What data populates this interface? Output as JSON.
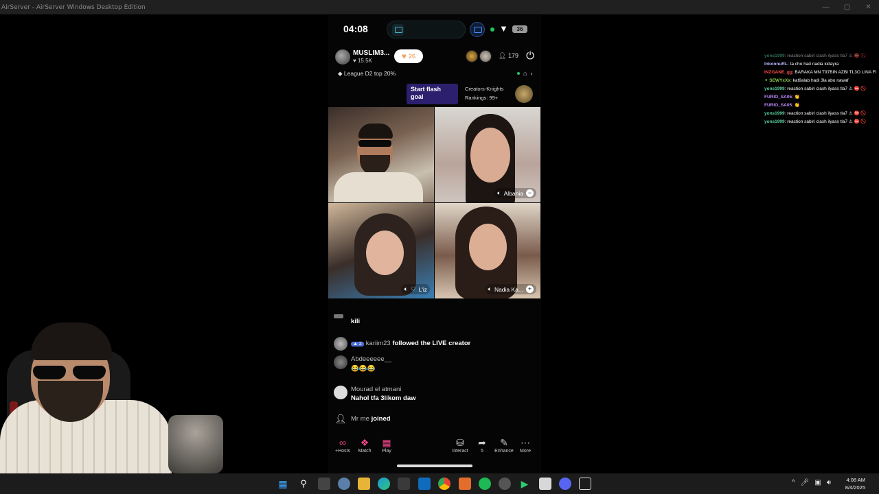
{
  "window": {
    "title": "AirServer - AirServer Windows Desktop Edition",
    "min": "—",
    "max": "▢",
    "close": "✕"
  },
  "status": {
    "time": "04:08",
    "battery": "36"
  },
  "host": {
    "name": "MUSLIM3...",
    "likes": "♥ 15.5K",
    "heart_count": "26",
    "viewers": "179",
    "league": "League D2 top 20%"
  },
  "flash": {
    "label": "Start flash goal",
    "creators_title": "Creators-Knights",
    "rankings": "Rankings: 99+"
  },
  "tiles": [
    {
      "label": ""
    },
    {
      "label": "Albania"
    },
    {
      "label": "L'iz"
    },
    {
      "label": "Nadia Ka..."
    }
  ],
  "chat": [
    {
      "name": "",
      "text": "kili"
    },
    {
      "badge": "2",
      "name": "kariim23",
      "text": "followed the LIVE creator"
    },
    {
      "name": "Abdeeeeee__",
      "text": "😂😂😂"
    },
    {
      "name": "Mourad el atmani",
      "text": "Nahol tfa 3likom daw"
    },
    {
      "name": "Mr me",
      "text": "joined"
    }
  ],
  "toolbar": {
    "hosts": "+Hosts",
    "match": "Match",
    "play": "Play",
    "interact": "Interact",
    "share": "5",
    "enhance": "Enhance",
    "more": "More"
  },
  "sidechat": [
    {
      "user": "yons1999",
      "msg": ": reaction sabiri clash ilyass tla7 ⚠ ⛔ 🚫",
      "color": "#5fd3a0"
    },
    {
      "user": "InkonnuRL",
      "msg": ": ta cho had nadia kidayra",
      "color": "#b7b7ff"
    },
    {
      "user": "INZGANE_gg",
      "msg": ": BARAKA MN T97BIN AZBI TL3O LINA FI",
      "color": "#ff4d4d"
    },
    {
      "user": "SEWYxXx",
      "msg": ": kat9alab hadi 3la abo nawaf",
      "color": "#8fd14f"
    },
    {
      "user": "yons1999",
      "msg": ": reaction sabiri clash ilyass tla7 ⚠ ⛔ 🚫",
      "color": "#5fd3a0"
    },
    {
      "user": "FURIO_SA05",
      "msg": ": 👏",
      "color": "#c08cff"
    },
    {
      "user": "FURIO_SA05",
      "msg": ": 👏",
      "color": "#c08cff"
    },
    {
      "user": "yons1999",
      "msg": ": reaction sabiri clash ilyass tla7 ⚠ ⛔ 🚫",
      "color": "#5fd3a0"
    },
    {
      "user": "yons1999",
      "msg": ": reaction sabiri clash ilyass tla7 ⚠ ⛔ 🚫",
      "color": "#5fd3a0"
    }
  ],
  "taskbar": {
    "time": "4:08 AM",
    "date": "8/4/2025",
    "chevron": "^"
  }
}
